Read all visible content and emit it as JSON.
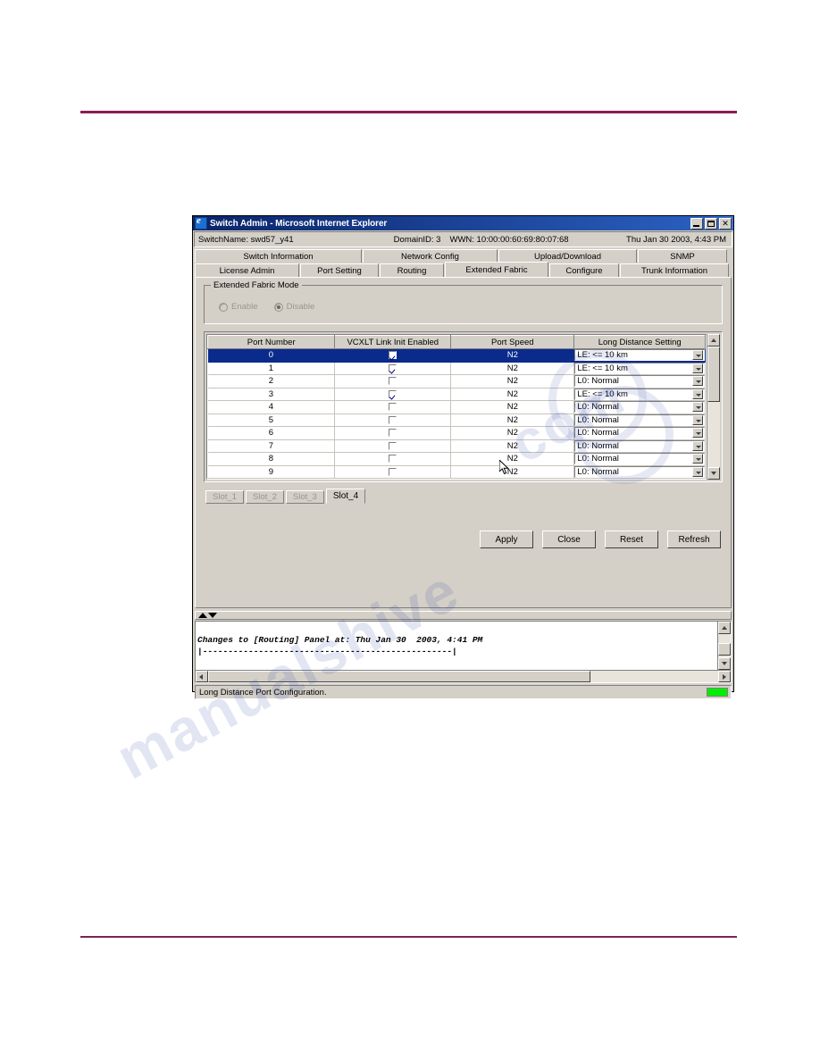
{
  "window": {
    "title": "Switch Admin - Microsoft Internet Explorer",
    "icon": "ie-icon",
    "minimize_label": "_",
    "maximize_label": "□",
    "close_label": "✕"
  },
  "infobar": {
    "switch_name": "SwitchName: swd57_y41",
    "domain_id": "DomainID: 3",
    "wwn": "WWN: 10:00:00:60:69:80:07:68",
    "datetime": "Thu Jan 30  2003, 4:43 PM"
  },
  "tabs": {
    "row1": [
      {
        "label": "Switch Information",
        "selected": false
      },
      {
        "label": "Network Config",
        "selected": false
      },
      {
        "label": "Upload/Download",
        "selected": false
      },
      {
        "label": "SNMP",
        "selected": false
      }
    ],
    "row2": [
      {
        "label": "License Admin",
        "selected": false
      },
      {
        "label": "Port Setting",
        "selected": false
      },
      {
        "label": "Routing",
        "selected": false
      },
      {
        "label": "Extended Fabric",
        "selected": true
      },
      {
        "label": "Configure",
        "selected": false
      },
      {
        "label": "Trunk Information",
        "selected": false
      }
    ]
  },
  "extended_fabric_mode": {
    "legend": "Extended Fabric Mode",
    "enabled_state": "disabled",
    "options": [
      {
        "label": "Enable",
        "checked": false
      },
      {
        "label": "Disable",
        "checked": true
      }
    ]
  },
  "table": {
    "headers": [
      "Port Number",
      "VCXLT Link Init Enabled",
      "Port Speed",
      "Long Distance Setting"
    ],
    "rows": [
      {
        "port": "0",
        "vcxlt": true,
        "speed": "N2",
        "long_distance": "LE: <= 10 km",
        "selected": true
      },
      {
        "port": "1",
        "vcxlt": true,
        "speed": "N2",
        "long_distance": "LE: <= 10 km",
        "selected": false
      },
      {
        "port": "2",
        "vcxlt": false,
        "speed": "N2",
        "long_distance": "L0: Normal",
        "selected": false
      },
      {
        "port": "3",
        "vcxlt": true,
        "speed": "N2",
        "long_distance": "LE: <= 10 km",
        "selected": false
      },
      {
        "port": "4",
        "vcxlt": false,
        "speed": "N2",
        "long_distance": "L0: Normal",
        "selected": false
      },
      {
        "port": "5",
        "vcxlt": false,
        "speed": "N2",
        "long_distance": "L0: Normal",
        "selected": false
      },
      {
        "port": "6",
        "vcxlt": false,
        "speed": "N2",
        "long_distance": "L0: Normal",
        "selected": false
      },
      {
        "port": "7",
        "vcxlt": false,
        "speed": "N2",
        "long_distance": "L0: Normal",
        "selected": false
      },
      {
        "port": "8",
        "vcxlt": false,
        "speed": "N2",
        "long_distance": "L0: Normal",
        "selected": false
      },
      {
        "port": "9",
        "vcxlt": false,
        "speed": "N2",
        "long_distance": "L0: Normal",
        "selected": false
      }
    ]
  },
  "slot_tabs": [
    {
      "label": "Slot_1",
      "active": false,
      "disabled": true
    },
    {
      "label": "Slot_2",
      "active": false,
      "disabled": true
    },
    {
      "label": "Slot_3",
      "active": false,
      "disabled": true
    },
    {
      "label": "Slot_4",
      "active": true,
      "disabled": false
    }
  ],
  "actions": [
    {
      "label": "Apply"
    },
    {
      "label": "Close"
    },
    {
      "label": "Reset"
    },
    {
      "label": "Refresh"
    }
  ],
  "console": {
    "line1": "Changes to [Routing] Panel at: Thu Jan 30  2003, 4:41 PM",
    "line2": "|-------------------------------------------------|"
  },
  "statusbar": {
    "text": "Long Distance Port Configuration.",
    "led_color": "#00ee00"
  },
  "watermark": {
    "text1": "manualshive",
    "text2": "com"
  }
}
